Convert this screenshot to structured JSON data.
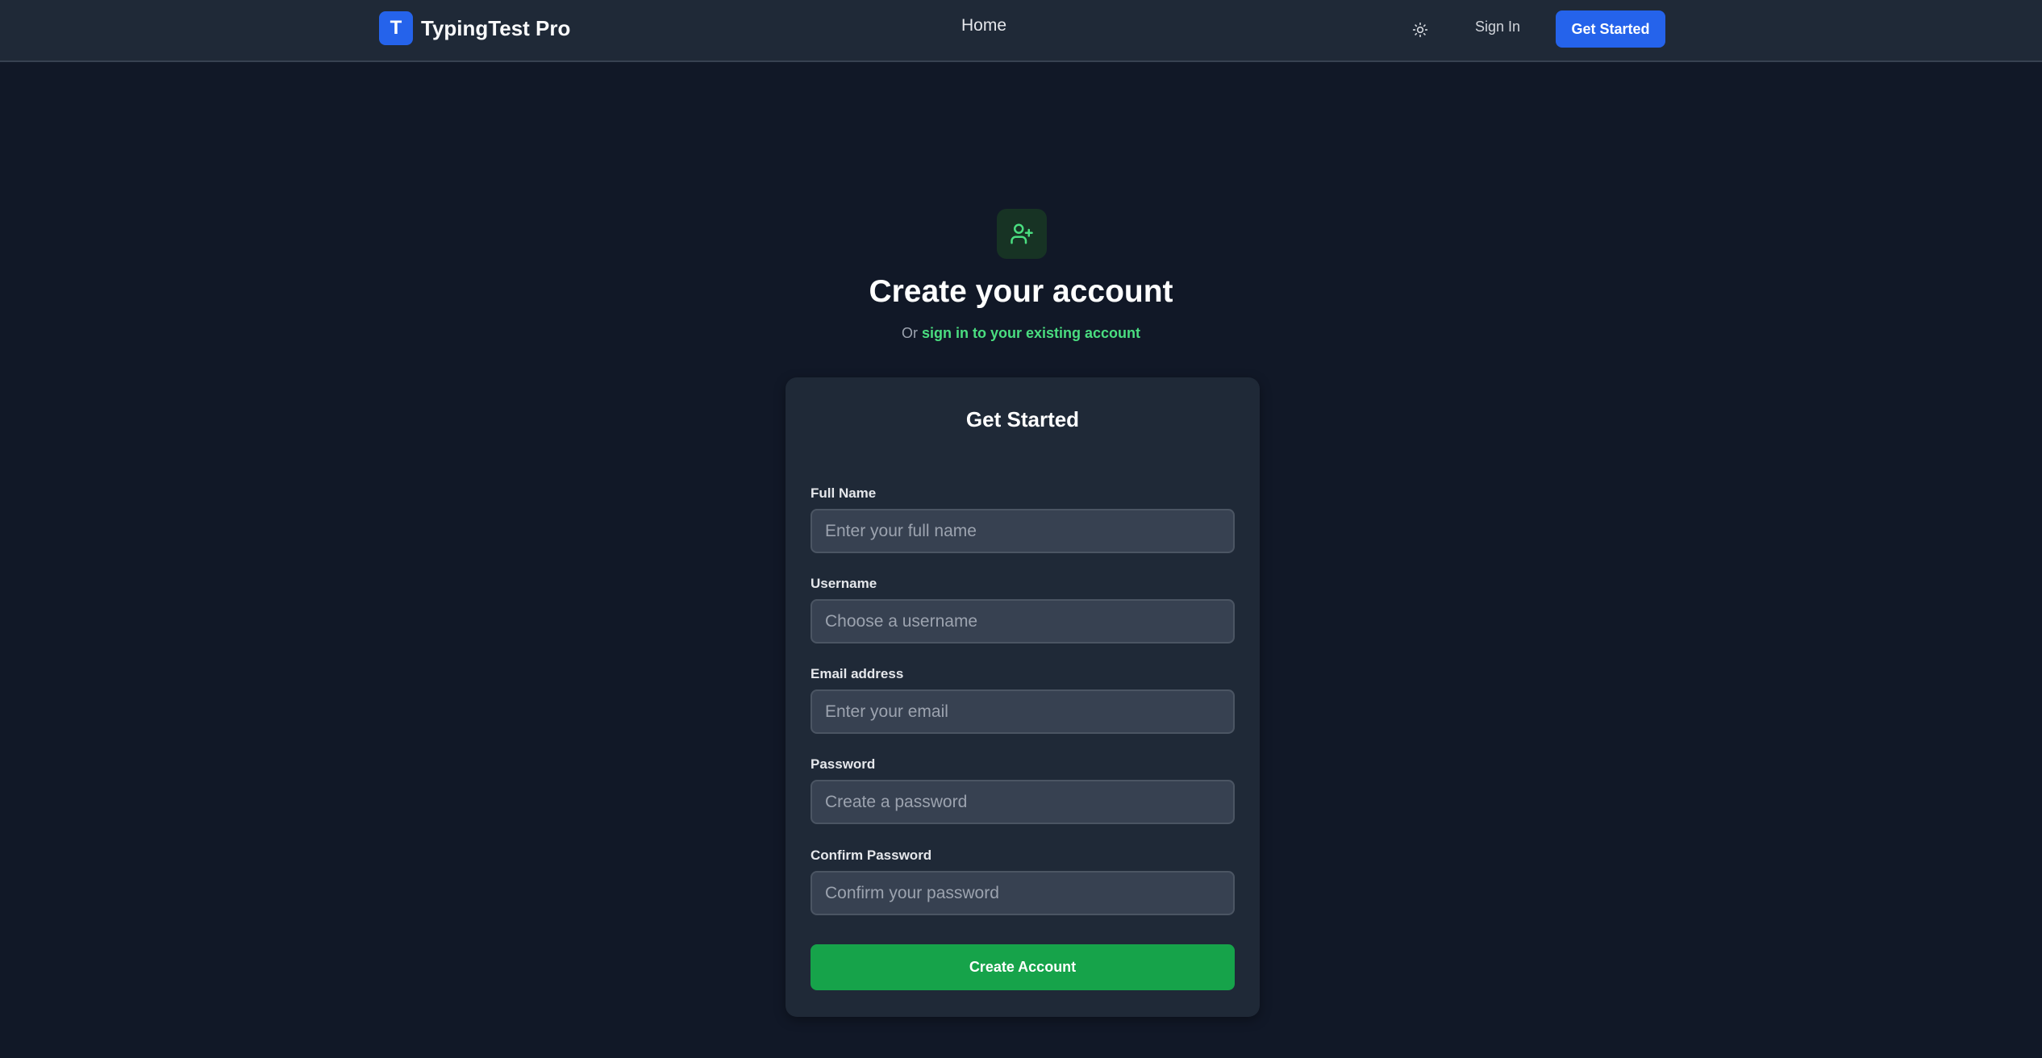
{
  "navbar": {
    "brand_letter": "T",
    "brand_name": "TypingTest Pro",
    "home_label": "Home",
    "theme_toggle_icon": "sun-icon",
    "signin_label": "Sign In",
    "get_started_label": "Get Started"
  },
  "header": {
    "icon": "user-plus-icon",
    "title": "Create your account",
    "subtitle_prefix": "Or",
    "subtitle_link": "sign in to your existing account"
  },
  "form": {
    "title": "Get Started",
    "fields": [
      {
        "label": "Full Name",
        "placeholder": "Enter your full name",
        "value": ""
      },
      {
        "label": "Username",
        "placeholder": "Choose a username",
        "value": ""
      },
      {
        "label": "Email address",
        "placeholder": "Enter your email",
        "value": ""
      },
      {
        "label": "Password",
        "placeholder": "Create a password",
        "value": ""
      },
      {
        "label": "Confirm Password",
        "placeholder": "Confirm your password",
        "value": ""
      }
    ],
    "submit_label": "Create Account"
  },
  "colors": {
    "background": "#111827",
    "navbar": "#1f2937",
    "card": "#1f2937",
    "input": "#374151",
    "primary_blue": "#2563eb",
    "accent_green": "#4ade80",
    "submit_green": "#16a34a"
  }
}
